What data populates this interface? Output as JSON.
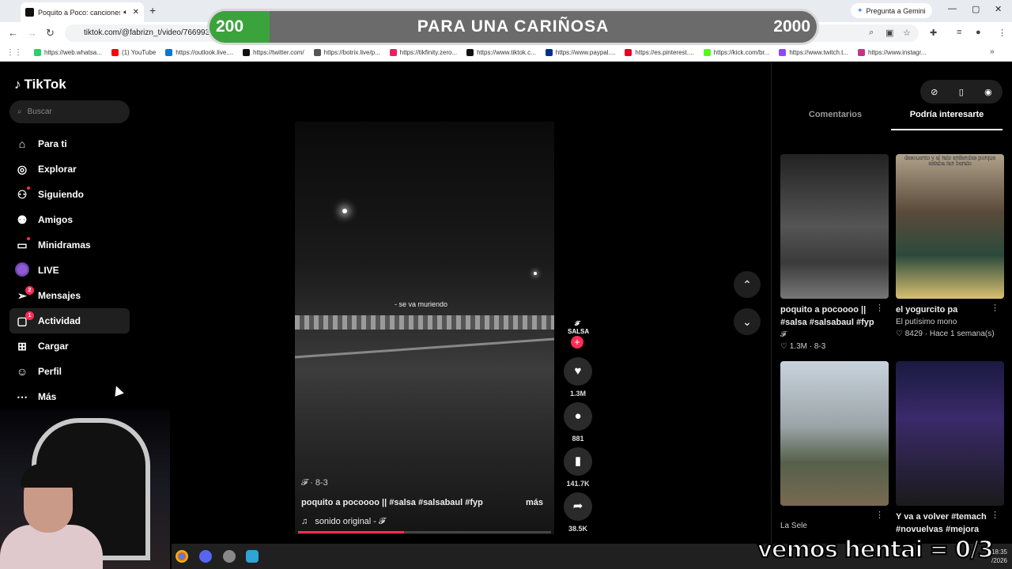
{
  "browser": {
    "tab_title": "Poquito a Poco: canciones y",
    "tab_close": "✕",
    "new_tab": "+",
    "address": "tiktok.com/@fabrizn_t/video/7669937",
    "gemini": "Pregunta a Gemini",
    "bookmarks": [
      "https://web.whatsa...",
      "(1) YouTube",
      "https://outlook.live....",
      "https://twitter.com/",
      "https://botrix.live/p...",
      "https://tikfinity.zero...",
      "https://www.tiktok.c...",
      "https://www.paypal....",
      "https://es.pinterest....",
      "https://kick.com/br...",
      "https://www.twitch.t...",
      "https://www.instagr..."
    ],
    "bookmark_colors": [
      "#25d366",
      "#ff0000",
      "#0078d4",
      "#111111",
      "#555555",
      "#e91e63",
      "#111111",
      "#003087",
      "#e60023",
      "#53fc18",
      "#9146ff",
      "#c13584"
    ]
  },
  "banner": {
    "left": "200",
    "center": "PARA UNA CARIÑOSA",
    "right": "2000"
  },
  "sidebar": {
    "logo": "TikTok",
    "search_placeholder": "Buscar",
    "items": [
      {
        "label": "Para ti",
        "icon": "home-icon"
      },
      {
        "label": "Explorar",
        "icon": "compass-icon"
      },
      {
        "label": "Siguiendo",
        "icon": "following-icon"
      },
      {
        "label": "Amigos",
        "icon": "friends-icon"
      },
      {
        "label": "Minidramas",
        "icon": "minidrama-icon"
      },
      {
        "label": "LIVE",
        "icon": "live-icon"
      },
      {
        "label": "Mensajes",
        "icon": "messages-icon",
        "badge": "2"
      },
      {
        "label": "Actividad",
        "icon": "activity-icon",
        "badge": "1"
      },
      {
        "label": "Cargar",
        "icon": "upload-icon"
      },
      {
        "label": "Perfil",
        "icon": "profile-icon"
      },
      {
        "label": "Más",
        "icon": "more-icon"
      }
    ]
  },
  "video": {
    "caption_overlay": "- se va muriendo",
    "user": "𝓕 · 8-3",
    "description": "poquito a pocoooo || #salsa #salsabaul #fyp",
    "more": "más",
    "sound": "sonido original - 𝓕",
    "progress": 0.42,
    "avatar_text": "𝓕 SALSA",
    "likes": "1.3M",
    "comments": "881",
    "saves": "141.7K",
    "shares": "38.5K"
  },
  "right_panel": {
    "tabs": [
      "Comentarios",
      "Podría interesarte"
    ],
    "cards": [
      {
        "title": "poquito a pocoooo || #salsa #salsabaul #fyp",
        "author": "𝓕",
        "likes": "1.3M",
        "date": "8-3",
        "overlay": ""
      },
      {
        "title": "el yogurcito pa",
        "author": "El putísimo mono",
        "likes": "8429",
        "date": "Hace 1 semana(s)",
        "overlay": "descuento y al rato entiendes porque estaba tan barato"
      },
      {
        "title": "",
        "author": "La Sele",
        "likes": "",
        "date": "",
        "overlay": ""
      },
      {
        "title": "Y va a volver #temach #novuelvas #mejora",
        "author": "",
        "likes": "",
        "date": "",
        "overlay": ""
      }
    ]
  },
  "taskbar": {
    "time": "18:35",
    "date": "/2026"
  },
  "overlay_text": "vemos hentai = 0/3"
}
